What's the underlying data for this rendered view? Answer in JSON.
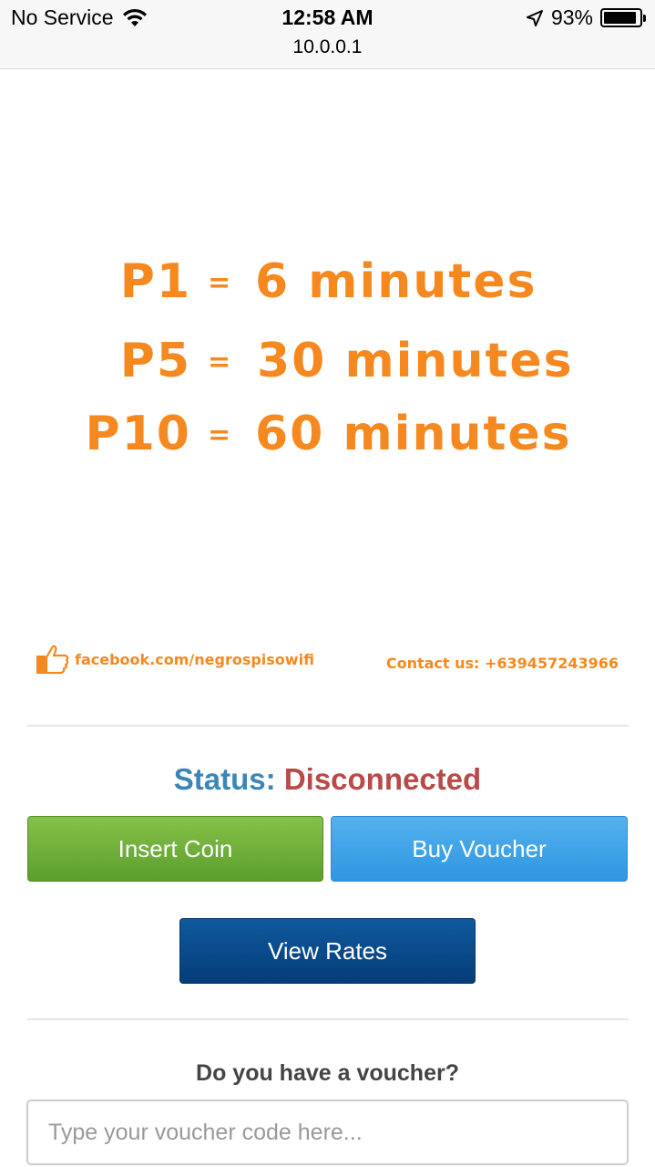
{
  "status_bar": {
    "carrier": "No Service",
    "time": "12:58 AM",
    "url": "10.0.0.1",
    "battery": "93%",
    "battery_level": 0.93
  },
  "rates": [
    {
      "amount": "P1",
      "eq": "=",
      "time": "6 minutes"
    },
    {
      "amount": "P5",
      "eq": "=",
      "time": "30 minutes"
    },
    {
      "amount": "P10",
      "eq": "=",
      "time": "60 minutes"
    }
  ],
  "banner": {
    "facebook": "facebook.com/negrospisowifi",
    "contact": "Contact us: +639457243966",
    "accent_color": "#f5891f"
  },
  "status": {
    "label": "Status:",
    "value": "Disconnected"
  },
  "buttons": {
    "insert_coin": "Insert Coin",
    "buy_voucher": "Buy Voucher",
    "view_rates": "View Rates"
  },
  "voucher": {
    "question": "Do you have a voucher?",
    "placeholder": "Type your voucher code here..."
  }
}
